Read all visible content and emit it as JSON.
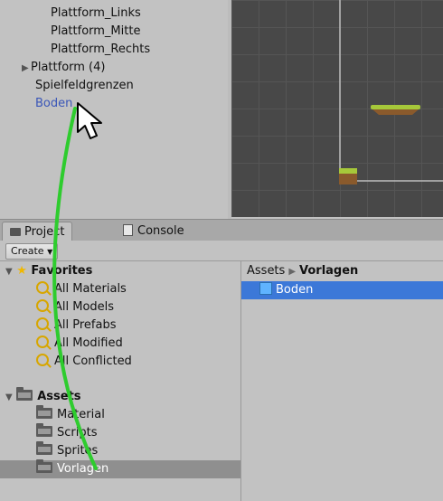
{
  "hierarchy": {
    "items": [
      {
        "label": "Plattform_Links"
      },
      {
        "label": "Plattform_Mitte"
      },
      {
        "label": "Plattform_Rechts"
      },
      {
        "label": "Plattform (4)"
      },
      {
        "label": "Spielfeldgrenzen"
      },
      {
        "label": "Boden"
      }
    ]
  },
  "tabs": {
    "project": "Project",
    "console": "Console"
  },
  "toolbar": {
    "create_label": "Create"
  },
  "tree": {
    "favorites_label": "Favorites",
    "favorites": [
      "All Materials",
      "All Models",
      "All Prefabs",
      "All Modified",
      "All Conflicted"
    ],
    "assets_label": "Assets",
    "folders": [
      "Material",
      "Scripts",
      "Sprites",
      "Vorlagen"
    ]
  },
  "files": {
    "breadcrumb_root": "Assets",
    "breadcrumb_current": "Vorlagen",
    "items": [
      {
        "label": "Boden"
      }
    ]
  },
  "colors": {
    "selection_blue": "#3c78d8",
    "drag_arrow": "#2ecc2e"
  }
}
